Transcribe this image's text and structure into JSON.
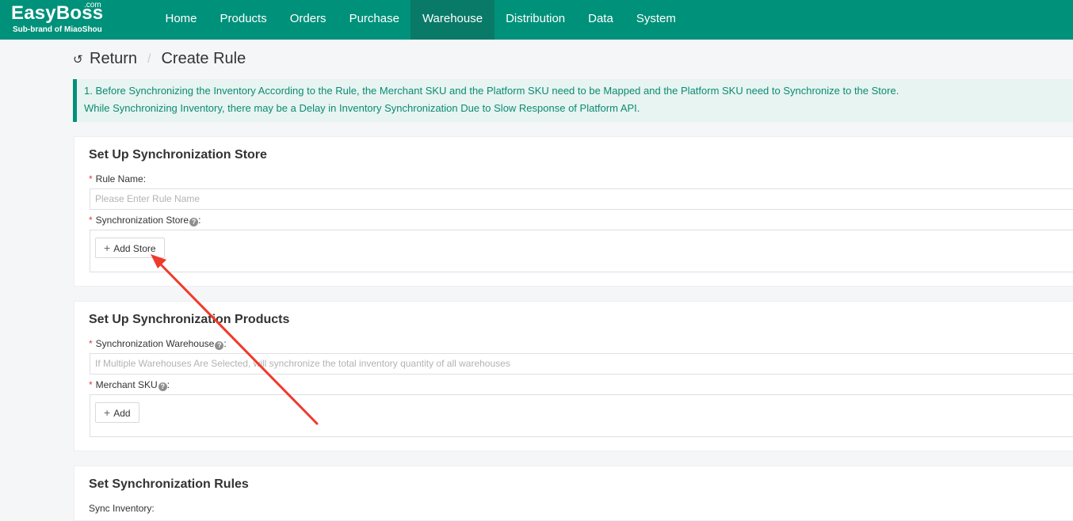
{
  "brand": {
    "name": "EasyBoss",
    "suffix": ".com",
    "tagline": "Sub-brand of MiaoShou"
  },
  "nav": {
    "items": [
      "Home",
      "Products",
      "Orders",
      "Purchase",
      "Warehouse",
      "Distribution",
      "Data",
      "System"
    ],
    "active": "Warehouse"
  },
  "header": {
    "return_label": "Return",
    "separator": "/",
    "title": "Create Rule"
  },
  "notice": {
    "line1": "1. Before Synchronizing the Inventory According to the Rule, the Merchant SKU and the Platform SKU need to be Mapped and the Platform SKU need to Synchronize to the Store.",
    "line2": "While Synchronizing Inventory, there may be a Delay in Inventory Synchronization Due to Slow Response of Platform API."
  },
  "store_section": {
    "title": "Set Up Synchronization Store",
    "rule_name_label": "Rule Name:",
    "rule_name_placeholder": "Please Enter Rule Name",
    "store_label": "Synchronization Store",
    "add_store_button": "Add Store"
  },
  "products_section": {
    "title": "Set Up Synchronization Products",
    "warehouse_label": "Synchronization Warehouse",
    "warehouse_placeholder": "If Multiple Warehouses Are Selected, will synchronize the total inventory quantity of all warehouses",
    "sku_label": "Merchant SKU",
    "add_button": "Add"
  },
  "rules_section": {
    "title": "Set Synchronization Rules",
    "sync_inventory_label": "Sync Inventory:"
  },
  "colors": {
    "primary": "#00917a",
    "nav_active": "#0a7a68",
    "notice_bg": "#e7f4f1",
    "required": "#e23c3c",
    "annotation_arrow": "#f03a2e"
  }
}
